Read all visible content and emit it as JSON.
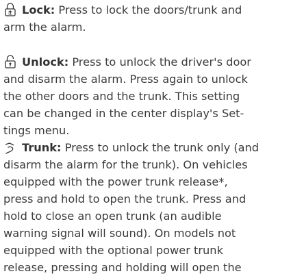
{
  "entries": [
    {
      "icon": "padlock-closed-icon",
      "label": "Lock:",
      "lines": [
        " Press to lock the doors/trunk and",
        "arm the alarm."
      ]
    },
    {
      "icon": "padlock-open-icon",
      "label": "Unlock:",
      "lines": [
        " Press to unlock the driver's door",
        "and disarm the alarm. Press again to unlock",
        "the other doors and the trunk. This setting",
        "can be changed in the center display's Set-",
        "tings menu."
      ]
    },
    {
      "icon": "trunk-open-icon",
      "label": "Trunk:",
      "lines": [
        " Press to unlock the trunk only (and",
        "disarm the alarm for the trunk). On vehicles",
        "equipped with the power trunk release*,",
        "press and hold to open the trunk. Press and",
        "hold to close an open trunk (an audible",
        "warning signal will sound). On models not",
        "equipped with the optional power trunk",
        "release, pressing and holding will open the"
      ]
    }
  ]
}
